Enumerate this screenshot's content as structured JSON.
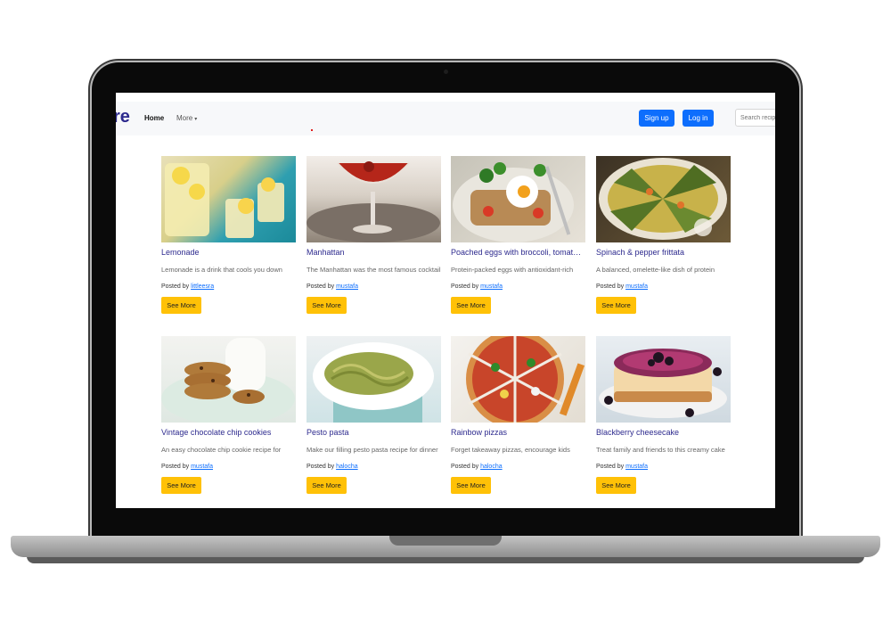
{
  "navbar": {
    "brand": "re",
    "links": [
      {
        "label": "Home"
      },
      {
        "label": "More"
      }
    ],
    "signup_label": "Sign up",
    "login_label": "Log in",
    "search_placeholder": "Search recipes"
  },
  "recipes": [
    {
      "title": "Lemonade",
      "desc": "Lemonade is a drink that cools you down",
      "posted_prefix": "Posted by",
      "author": "littleesra",
      "button": "See More",
      "image": "lemonade"
    },
    {
      "title": "Manhattan",
      "desc": "The Manhattan was the most famous cocktail",
      "posted_prefix": "Posted by",
      "author": "mustafa",
      "button": "See More",
      "image": "manhattan"
    },
    {
      "title": "Poached eggs with broccoli, tomatoes",
      "desc": "Protein-packed eggs with antioxidant-rich",
      "posted_prefix": "Posted by",
      "author": "mustafa",
      "button": "See More",
      "image": "poached-eggs"
    },
    {
      "title": "Spinach & pepper frittata",
      "desc": "A balanced, omelette-like dish of protein",
      "posted_prefix": "Posted by",
      "author": "mustafa",
      "button": "See More",
      "image": "frittata"
    },
    {
      "title": "Vintage chocolate chip cookies",
      "desc": "An easy chocolate chip cookie recipe for",
      "posted_prefix": "Posted by",
      "author": "mustafa",
      "button": "See More",
      "image": "cookies"
    },
    {
      "title": "Pesto pasta",
      "desc": "Make our filling pesto pasta recipe for dinner",
      "posted_prefix": "Posted by",
      "author": "halocha",
      "button": "See More",
      "image": "pesto-pasta"
    },
    {
      "title": "Rainbow pizzas",
      "desc": "Forget takeaway pizzas, encourage kids",
      "posted_prefix": "Posted by",
      "author": "halocha",
      "button": "See More",
      "image": "pizza"
    },
    {
      "title": "Blackberry cheesecake",
      "desc": "Treat family and friends to this creamy cake",
      "posted_prefix": "Posted by",
      "author": "mustafa",
      "button": "See More",
      "image": "cheesecake"
    }
  ],
  "colors": {
    "accent_blue": "#0d6efd",
    "button_yellow": "#ffc107",
    "title_color": "#2d2a8e"
  }
}
